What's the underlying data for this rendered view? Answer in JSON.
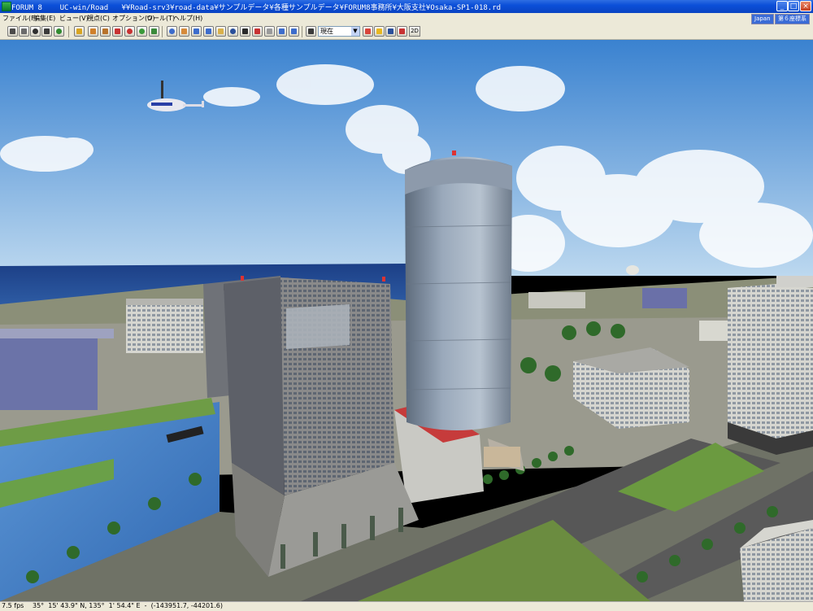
{
  "window": {
    "app_name": "FORUM 8",
    "title": "UC-win/Road   ¥¥Road-srv3¥road-data¥サンプルデータ¥各種サンプルデータ¥FORUM8事務所¥大阪支社¥Osaka-SP1-018.rd"
  },
  "menu": {
    "items": [
      "ファイル(F)",
      "編集(E)",
      "ビュー(V)",
      "視点(C)",
      "オプション(O)",
      "ツール(T)",
      "ヘルプ(H)"
    ],
    "locale": "Japan",
    "coord_system": "第６座標系"
  },
  "toolbar": {
    "time_select_value": "現在",
    "twod_label": "2D",
    "icons": [
      "new-file-icon",
      "open-file-icon",
      "person-icon",
      "walk-icon",
      "tree-icon",
      "export-icon",
      "settings-icon",
      "layers-icon",
      "car-icon",
      "stop-icon",
      "refresh-icon",
      "nav-icon",
      "target-icon",
      "move-icon",
      "pan-icon",
      "zoom-icon",
      "rotate-icon",
      "light-icon",
      "weather-icon",
      "view-icon",
      "car2-icon",
      "car3-icon",
      "scenario-icon",
      "shadow-icon",
      "sun-icon",
      "record-icon",
      "play-icon",
      "flag-icon"
    ]
  },
  "status": {
    "fps": "7.5 fps",
    "location": "35°  15' 43.9\" N, 135°  1' 54.4\" E  -  (-143951.7, -44201.6)"
  },
  "colors": {
    "sky_top": "#3d83d1",
    "sky_horizon": "#b9d6ee",
    "water": "#3b6fb4",
    "grass": "#5f8b3a",
    "road": "#5c5c5c"
  }
}
